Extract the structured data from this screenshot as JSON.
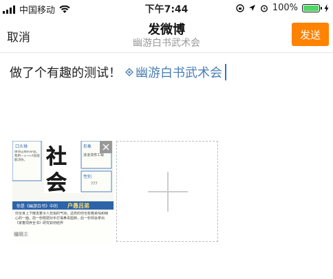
{
  "status_bar": {
    "carrier": "中国移动",
    "time": "下午7:44",
    "battery_percent": "100%",
    "battery_level": 1.0,
    "icons": [
      "signal-icon",
      "wifi-icon",
      "rotation-lock-icon",
      "location-icon",
      "alarm-icon",
      "battery-icon",
      "charging-icon"
    ]
  },
  "nav": {
    "cancel_label": "取消",
    "title": "发微博",
    "subtitle": "幽游白书武术会",
    "send_label": "发送",
    "send_color": "#ff8200"
  },
  "compose": {
    "text": "做了个有趣的测试！",
    "topic": "幽游白书武术会",
    "topic_color": "#4a7fb5"
  },
  "thumbnail": {
    "big_chars": "社会",
    "label_1": "口头禅",
    "label_2": "形象",
    "label_3": "性别",
    "text_1": "像你这样的杂鱼，我用一±→+A就能解决你。",
    "text_2": "凌凌漆修工栽",
    "text_3": "???",
    "band_text": "你是《幽游白书》中的",
    "band_name": "户愚吕弟",
    "body_text": "你全身上下散发着令人恐惧的气场，这样的你也有着柔情和细心的一面，前一秒刚把对手打得鼻青脸肿，后一秒却会拿出《家畜饲养全书》研究如何结界",
    "watermark": "编辑主"
  },
  "attach": {
    "remove_icon": "close-icon",
    "add_icon": "plus-icon"
  }
}
